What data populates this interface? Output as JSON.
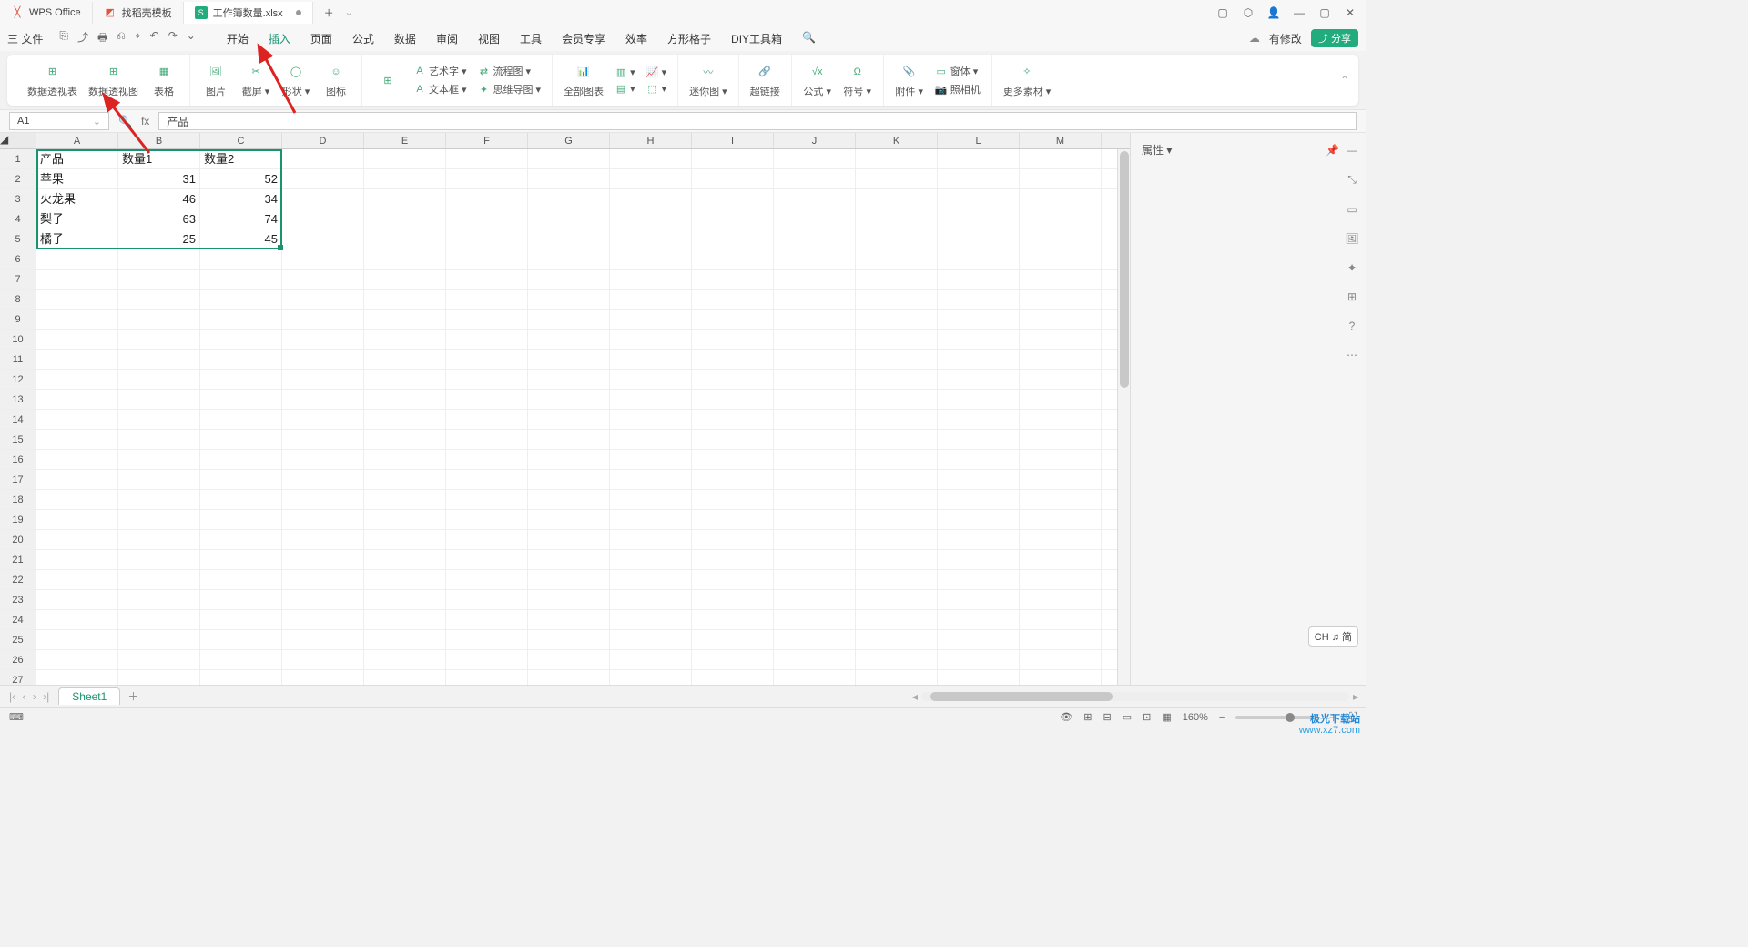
{
  "titlebar": {
    "tabs": [
      {
        "icon": "#d94b3a",
        "label": "WPS Office"
      },
      {
        "icon": "#e2553c",
        "label": "找稻壳模板"
      },
      {
        "icon": "#22ab7c",
        "label": "工作簿数量.xlsx",
        "active": true,
        "modified": true
      }
    ],
    "add": "＋"
  },
  "menubar": {
    "menu": "三 文件",
    "quick": [
      "⎘",
      "⤴",
      "🖶",
      "⎌",
      "⌖",
      "↶",
      "↷",
      "⌄"
    ],
    "tabs": [
      "开始",
      "插入",
      "页面",
      "公式",
      "数据",
      "审阅",
      "视图",
      "工具",
      "会员专享",
      "效率",
      "方形格子",
      "DIY工具箱"
    ],
    "active": "插入",
    "search": "🔍",
    "right": {
      "pending": "有修改",
      "share": "分享"
    }
  },
  "ribbon": {
    "g1": [
      {
        "label": "数据透视表"
      },
      {
        "label": "数据透视图"
      },
      {
        "label": "表格"
      }
    ],
    "g2": {
      "col": [
        {
          "label": "图片"
        }
      ],
      "rows": [
        {
          "label": "截屏",
          "drop": true
        },
        {
          "label": "形状",
          "drop": true
        },
        {
          "label": "图标"
        }
      ]
    },
    "g3": {
      "left": {
        "label": "⊞"
      },
      "minis": [
        "艺术字",
        "文本框",
        "思维导图",
        "流程图"
      ]
    },
    "g4": {
      "items": [
        {
          "label": "全部图表"
        },
        {
          "label": "📊",
          "drop": true
        },
        {
          "label": "📈",
          "drop": true
        },
        {
          "label": "⬚",
          "drop": true
        }
      ]
    },
    "g5": {
      "items": [
        {
          "label": "迷你图",
          "drop": true
        }
      ]
    },
    "g6": {
      "items": [
        {
          "label": "超链接"
        }
      ]
    },
    "g7": {
      "items": [
        {
          "label": "公式",
          "drop": true
        },
        {
          "label": "符号",
          "drop": true
        }
      ]
    },
    "g8": {
      "items": [
        {
          "label": "附件",
          "drop": true
        },
        {
          "label": "窗体",
          "drop": true
        },
        {
          "label": "照相机"
        }
      ]
    },
    "g9": {
      "items": [
        {
          "label": "更多素材",
          "drop": true
        }
      ]
    }
  },
  "fbar": {
    "name": "A1",
    "fx": "fx",
    "value": "产品"
  },
  "grid": {
    "cols": [
      "A",
      "B",
      "C",
      "D",
      "E",
      "F",
      "G",
      "H",
      "I",
      "J",
      "K",
      "L",
      "M"
    ],
    "rows": 27,
    "data": [
      [
        "产品",
        "数量1",
        "数量2"
      ],
      [
        "苹果",
        "31",
        "52"
      ],
      [
        "火龙果",
        "46",
        "34"
      ],
      [
        "梨子",
        "63",
        "74"
      ],
      [
        "橘子",
        "25",
        "45"
      ]
    ]
  },
  "rpanel": {
    "title": "属性",
    "pin": "📌",
    "close": "✕",
    "tools": [
      "—",
      "⤡",
      "▭",
      "🖼",
      "✦",
      "⊞",
      "?",
      "⋯"
    ]
  },
  "ime": "CH ♫ 简",
  "sheetbar": {
    "nav": [
      "|‹",
      "‹",
      "›",
      "›|"
    ],
    "sheet": "Sheet1",
    "add": "＋"
  },
  "status": {
    "left": "⌨",
    "zoom": "160%",
    "icons": [
      "👁",
      "⊞",
      "⊟",
      "▭",
      "⊡",
      "▦"
    ]
  },
  "watermark": {
    "pri": "极光下载站",
    "sec": "www.xz7.com"
  }
}
